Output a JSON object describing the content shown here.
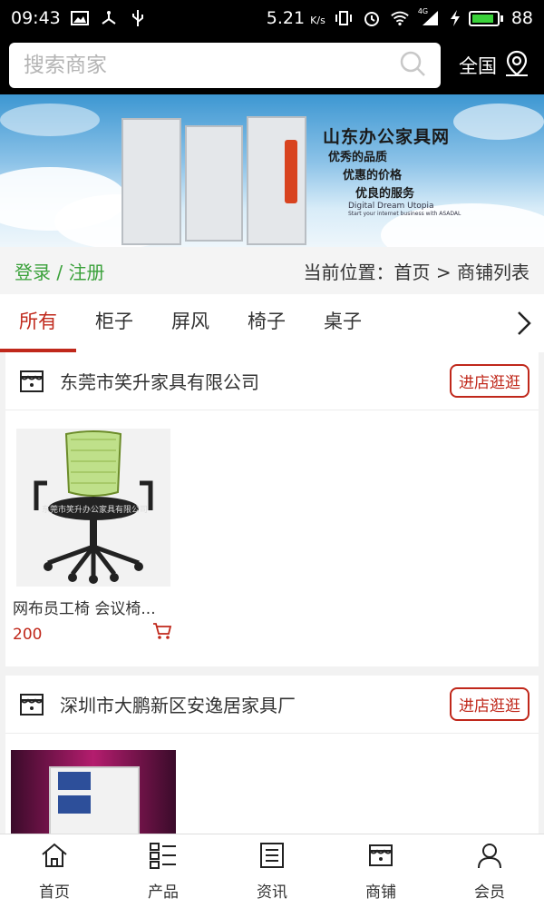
{
  "status_bar": {
    "time": "09:43",
    "network_speed": "5.21",
    "network_speed_unit": "K/s",
    "signal_label": "4G",
    "battery_level": "88",
    "battery_fill": 0.88,
    "icons": [
      "image-icon",
      "usb-share-icon",
      "usb-icon",
      "vibrate-icon",
      "alarm-icon",
      "wifi-icon",
      "signal-icon",
      "charging-icon",
      "battery-icon"
    ]
  },
  "search": {
    "placeholder": "搜索商家",
    "region_label": "全国"
  },
  "banner": {
    "title": "山东办公家具网",
    "slogans": [
      "优秀的品质",
      "优惠的价格",
      "优良的服务"
    ],
    "en_title": "Digital Dream Utopia",
    "en_sub": "Start your internet business with ASADAL"
  },
  "crumbbar": {
    "login": "登录 / 注册",
    "breadcrumb": "当前位置：首页 > 商铺列表"
  },
  "tabs": [
    {
      "label": "所有",
      "active": true
    },
    {
      "label": "柜子",
      "active": false
    },
    {
      "label": "屏风",
      "active": false
    },
    {
      "label": "椅子",
      "active": false
    },
    {
      "label": "桌子",
      "active": false
    }
  ],
  "shops": [
    {
      "name": "东莞市笑升家具有限公司",
      "button": "进店逛逛",
      "products": [
        {
          "name": "网布员工椅 会议椅...",
          "price": "200",
          "watermark": "东莞市笑升办公家具有限公司"
        }
      ]
    },
    {
      "name": "深圳市大鹏新区安逸居家具厂",
      "button": "进店逛逛",
      "products": []
    }
  ],
  "bottom_nav": [
    {
      "label": "首页",
      "icon": "home-icon"
    },
    {
      "label": "产品",
      "icon": "list-icon"
    },
    {
      "label": "资讯",
      "icon": "news-icon"
    },
    {
      "label": "商铺",
      "icon": "shop-icon"
    },
    {
      "label": "会员",
      "icon": "user-icon"
    }
  ],
  "colors": {
    "accent": "#c0281b",
    "login_green": "#3aa13a",
    "status_bg": "#000000"
  }
}
